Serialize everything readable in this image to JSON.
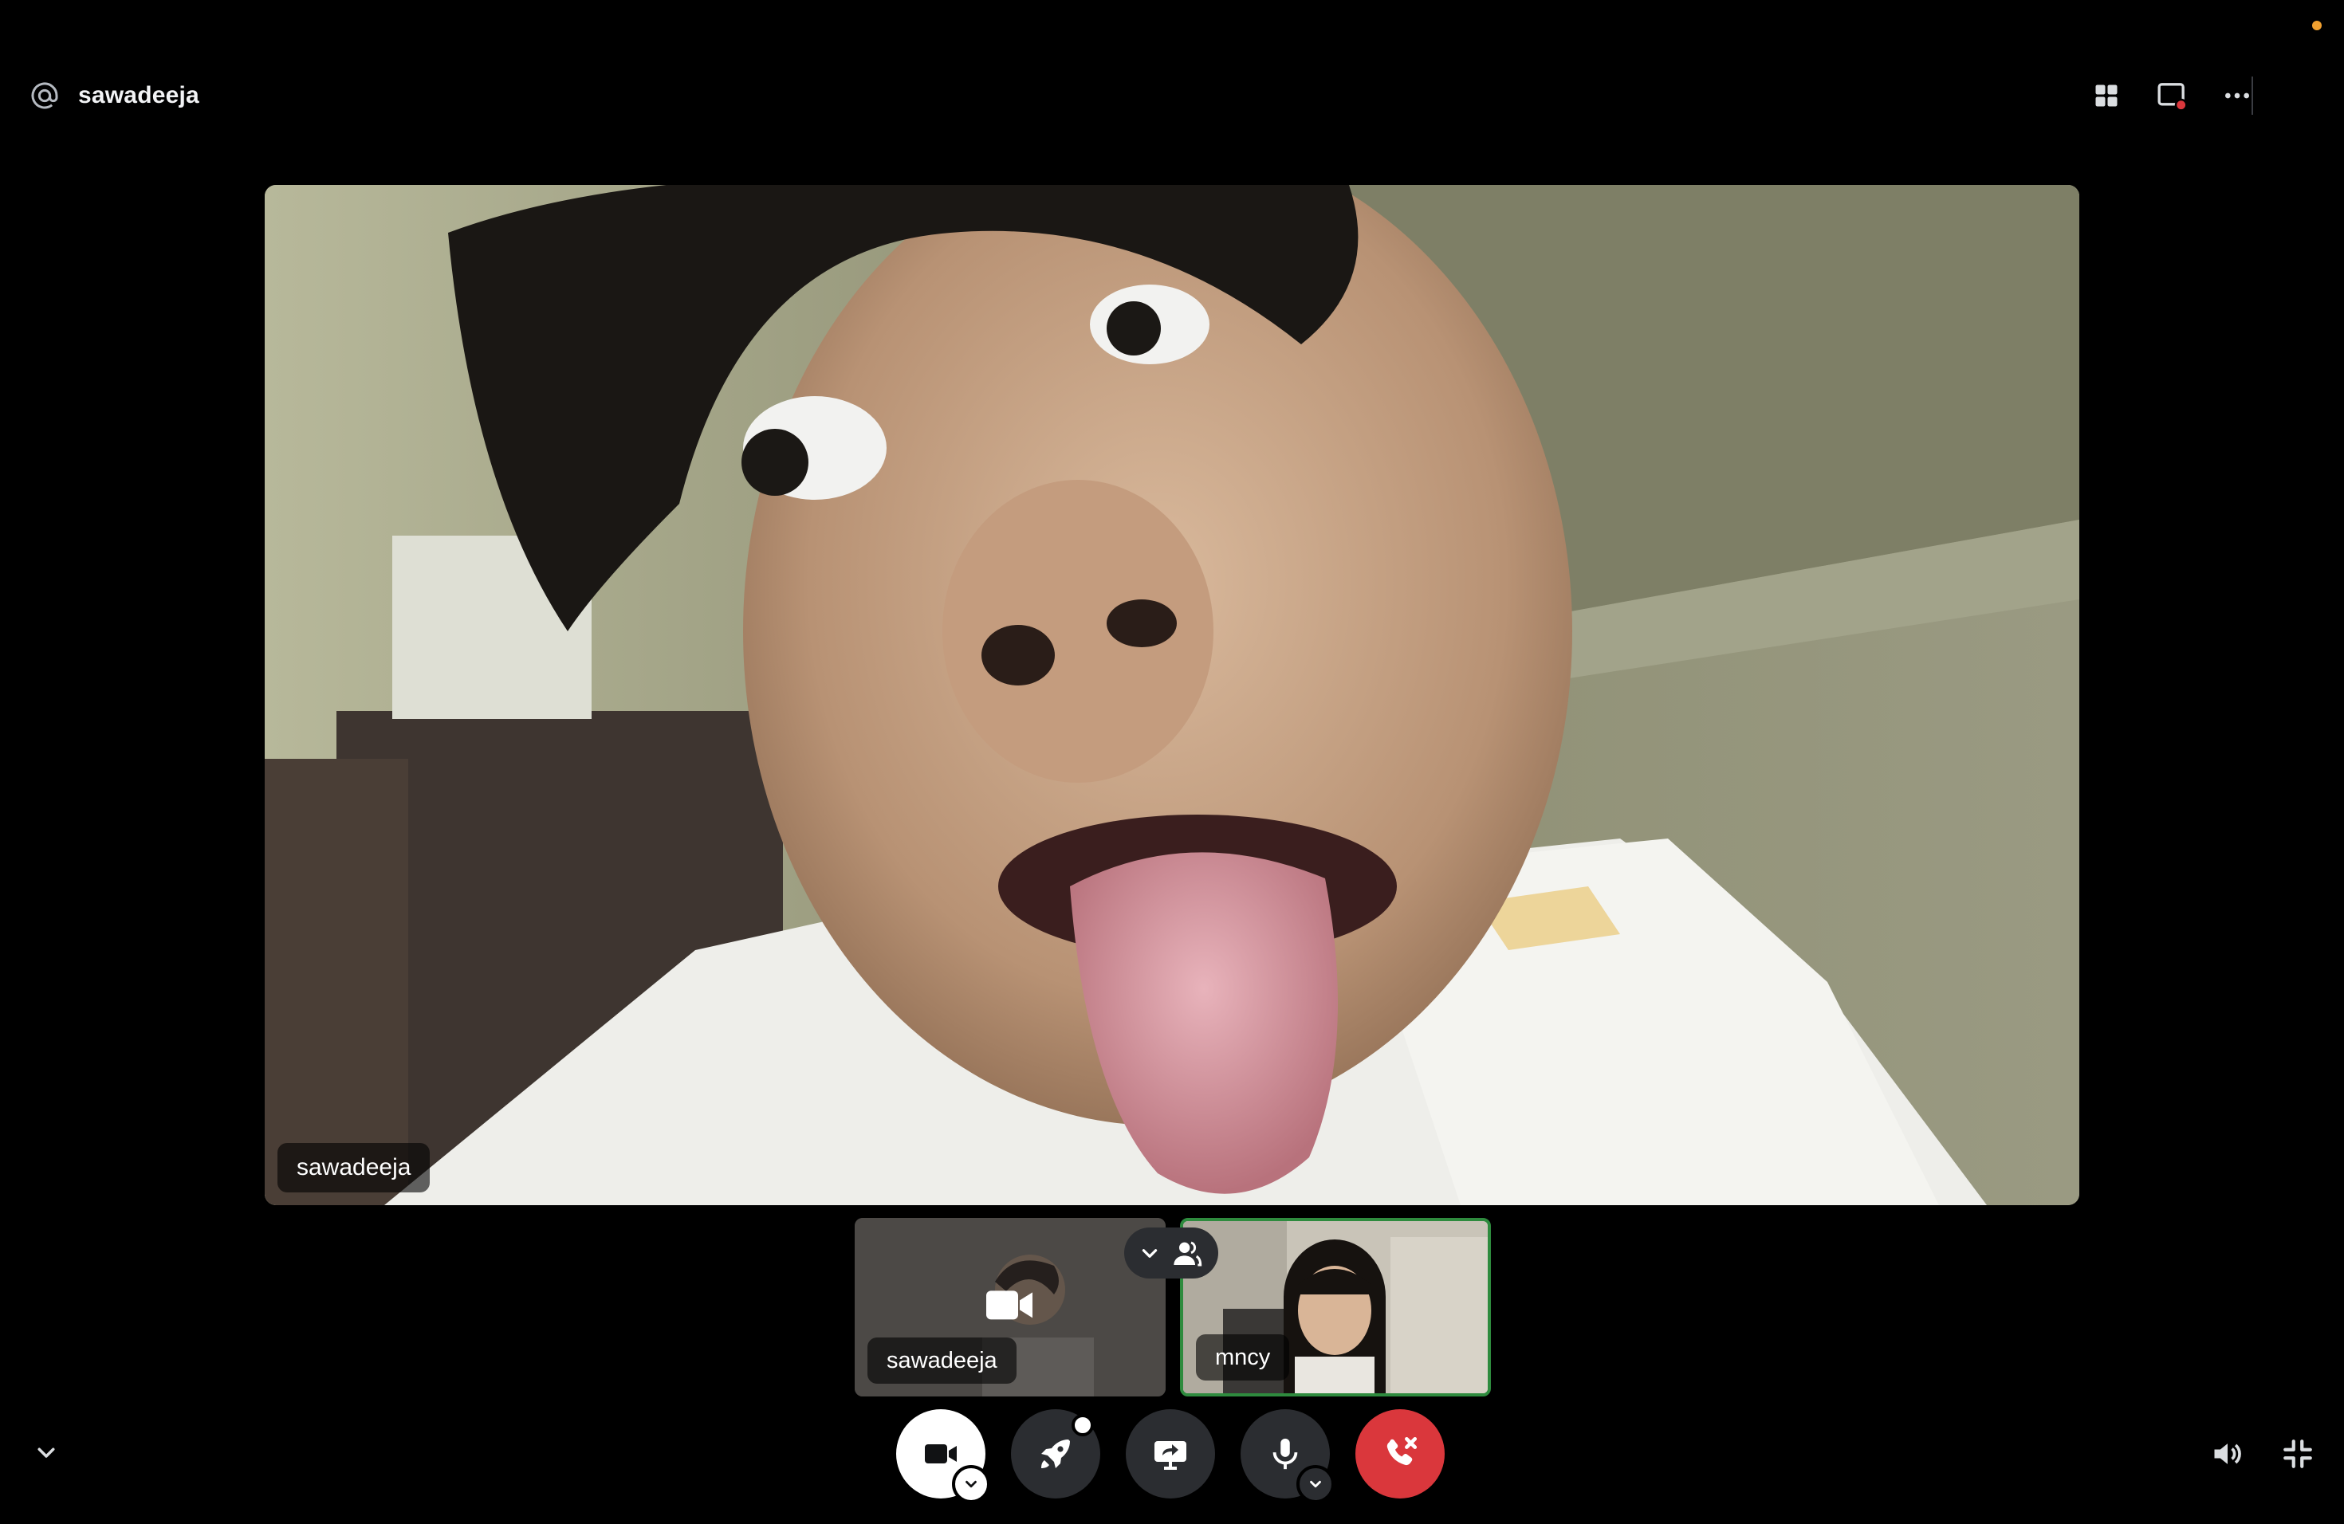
{
  "header": {
    "channel_name": "sawadeeja",
    "icons": [
      "at-sign-icon",
      "grid-layout-icon",
      "popout-icon",
      "more-options-icon"
    ]
  },
  "main_stage": {
    "participant_name": "sawadeeja"
  },
  "thumbnails": [
    {
      "participant_name": "sawadeeja",
      "camera_off_icon": "video-camera-icon"
    },
    {
      "participant_name": "mncy",
      "speaking": true
    }
  ],
  "controls": {
    "buttons": [
      "camera",
      "activities",
      "screen-share",
      "microphone",
      "disconnect"
    ]
  },
  "colors": {
    "background": "#000000",
    "control_bg": "#2b2d31",
    "end_call": "#da373c",
    "speaking_border": "#2e8b3e",
    "notification_dot": "#f0a030"
  }
}
